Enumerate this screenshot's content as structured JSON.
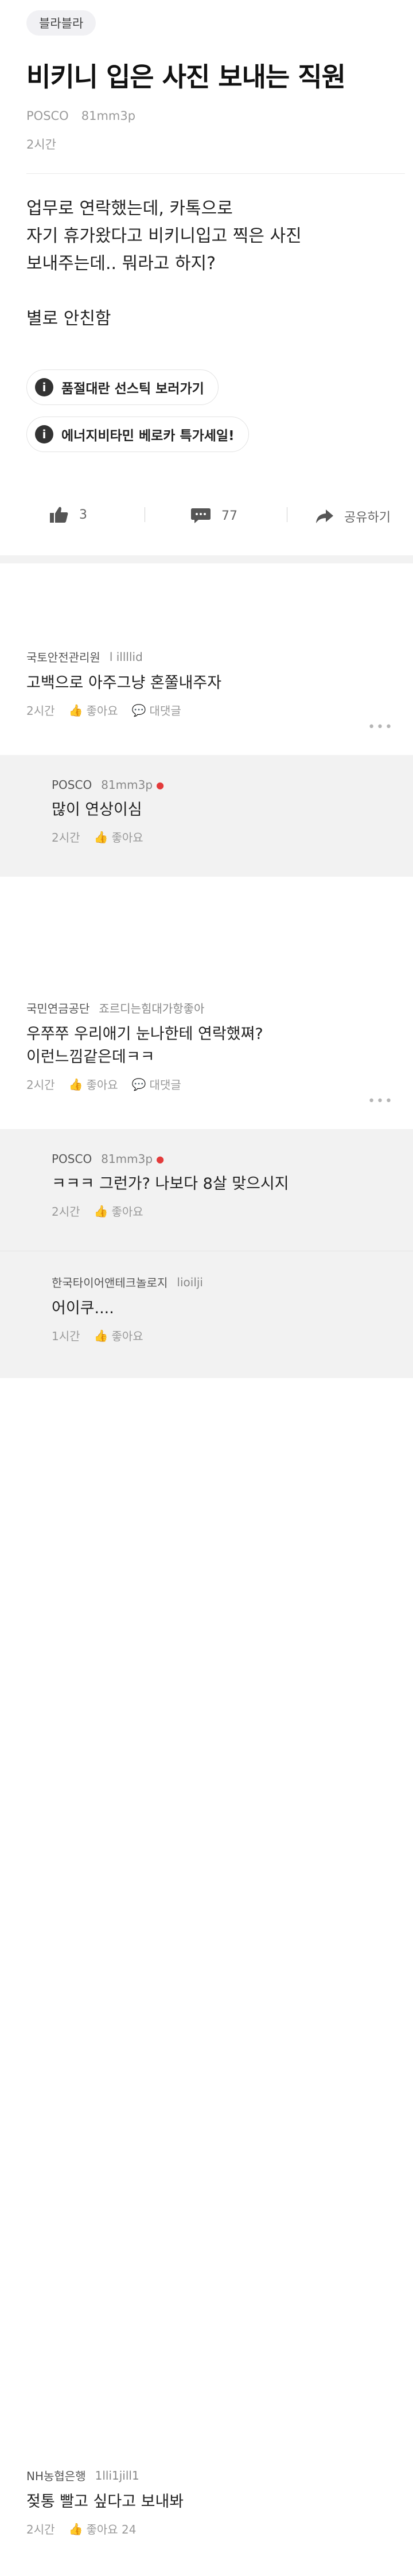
{
  "board": "블라블라",
  "post": {
    "title": "비키니 입은 사진 보내는 직원",
    "company": "POSCO",
    "nickname": "81mm3p",
    "time": "2시간",
    "body": "업무로 연락했는데, 카톡으로\n자기 휴가왔다고 비키니입고 찍은 사진\n보내주는데.. 뭐라고 하지?\n\n별로 안친함"
  },
  "promos": [
    "품절대란 선스틱 보러가기",
    "에너지비타민 베로카 특가세일!"
  ],
  "actions": {
    "likes": "3",
    "comments": "77",
    "share": "공유하기"
  },
  "labels": {
    "like": "좋아요",
    "reply": "대댓글"
  },
  "comments": [
    {
      "company": "국토안전관리원",
      "nickname": "l illllid",
      "text": "고백으로 아주그냥 혼쭐내주자",
      "time": "2시간"
    },
    {
      "company": "POSCO",
      "nickname": "81mm3p",
      "text": "많이 연상이심",
      "time": "2시간"
    },
    {
      "company": "국민연금공단",
      "nickname": "죠르디는힘대가항좋아",
      "text": "우쭈쭈 우리애기 눈나한테 연락했쪄?\n이런느낌같은데ㅋㅋ",
      "time": "2시간"
    },
    {
      "company": "POSCO",
      "nickname": "81mm3p",
      "text": "ㅋㅋㅋ 그런가? 나보다 8살 맞으시지",
      "time": "2시간"
    },
    {
      "company": "한국타이어앤테크놀로지",
      "nickname": "lioilji",
      "text": "어이쿠....",
      "time": "1시간"
    },
    {
      "company": "NH농협은행",
      "nickname": "1lli1jill1",
      "text": "젖통 빨고 싶다고 보내봐",
      "time": "2시간",
      "likes": "좋아요 24"
    }
  ]
}
